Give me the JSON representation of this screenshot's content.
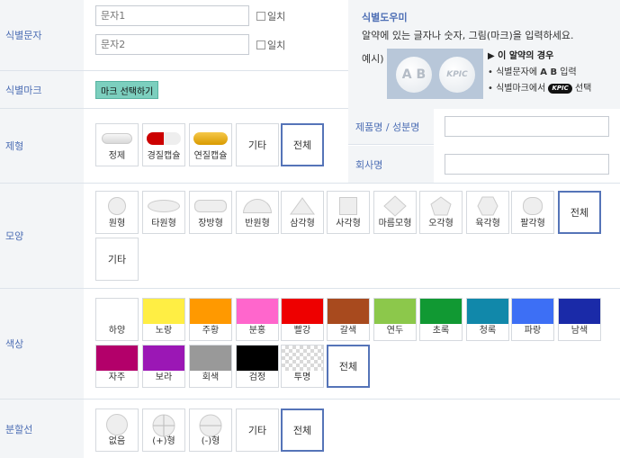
{
  "imprint": {
    "label": "식별문자",
    "input1_placeholder": "문자1",
    "input2_placeholder": "문자2",
    "exact_label": "일치"
  },
  "helper": {
    "title": "식별도우미",
    "desc": "알약에 있는 글자나 숫자, 그림(마크)을 입력하세요.",
    "example_label": "예시)",
    "pill_text_1": "A B",
    "pill_text_2": "KPIC",
    "case_title": "▶ 이 알약의 경우",
    "case_line1_prefix": "• 식별문자에 ",
    "case_line1_bold": "A B",
    "case_line1_suffix": " 입력",
    "case_line2_prefix": "• 식별마크에서 ",
    "case_line2_logo": "KPIC",
    "case_line2_suffix": " 선택"
  },
  "mark": {
    "label": "식별마크",
    "button": "마크 선택하기"
  },
  "form": {
    "label": "제형",
    "options": [
      "정제",
      "경질캡슐",
      "연질캡슐",
      "기타",
      "전체"
    ]
  },
  "product": {
    "name_label": "제품명 / 성분명",
    "company_label": "회사명"
  },
  "shape": {
    "label": "모양",
    "options": [
      "원형",
      "타원형",
      "장방형",
      "반원형",
      "삼각형",
      "사각형",
      "마름모형",
      "오각형",
      "육각형",
      "팔각형",
      "전체",
      "기타"
    ]
  },
  "color": {
    "label": "색상",
    "options": [
      {
        "name": "하양",
        "hex": "#ffffff"
      },
      {
        "name": "노랑",
        "hex": "#ffee44"
      },
      {
        "name": "주황",
        "hex": "#ff9900"
      },
      {
        "name": "분홍",
        "hex": "#ff66cc"
      },
      {
        "name": "빨강",
        "hex": "#ee0000"
      },
      {
        "name": "갈색",
        "hex": "#a84a1e"
      },
      {
        "name": "연두",
        "hex": "#8cc84b"
      },
      {
        "name": "초록",
        "hex": "#119933"
      },
      {
        "name": "청록",
        "hex": "#1188aa"
      },
      {
        "name": "파랑",
        "hex": "#3d6ff5"
      },
      {
        "name": "남색",
        "hex": "#1a2aa8"
      },
      {
        "name": "자주",
        "hex": "#b3006a"
      },
      {
        "name": "보라",
        "hex": "#9b17b5"
      },
      {
        "name": "회색",
        "hex": "#999999"
      },
      {
        "name": "검정",
        "hex": "#000000"
      },
      {
        "name": "투명",
        "hex": "checker"
      },
      {
        "name": "전체",
        "hex": ""
      }
    ]
  },
  "score": {
    "label": "분할선",
    "options": [
      "없음",
      "(+)형",
      "(-)형",
      "기타",
      "전체"
    ]
  }
}
